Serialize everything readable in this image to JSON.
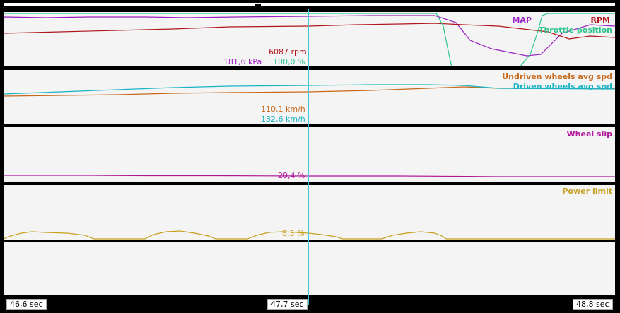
{
  "panels": {
    "engine": {
      "map_label": "MAP",
      "rpm_label": "RPM",
      "throttle_label": "Throttle position",
      "rpm_value": "6087 rpm",
      "map_value": "181,6 kPa",
      "throttle_value": "100,0 %"
    },
    "wheels": {
      "undriven_label": "Undriven wheels avg spd",
      "driven_label": "Driven wheels avg spd",
      "undriven_value": "110,1 km/h",
      "driven_value": "132,6 km/h"
    },
    "slip": {
      "label": "Wheel slip",
      "value": "20,4 %"
    },
    "power": {
      "label": "Power limit",
      "value": "6,3 %"
    }
  },
  "timeline": {
    "start": "46,6 sec",
    "cursor": "47,7 sec",
    "end": "48,8 sec"
  },
  "colors": {
    "map": "#9b1fc2",
    "rpm": "#b0161c",
    "throttle": "#2ec48c",
    "undriven": "#c8681a",
    "driven": "#18b4c4",
    "slip": "#b0169a",
    "power": "#c8a020",
    "cursor": "#3cc8d8"
  },
  "chart_data": [
    {
      "type": "line",
      "x_range": [
        46.6,
        48.8
      ],
      "series": [
        {
          "name": "MAP",
          "x": [
            46.6,
            46.9,
            47.2,
            47.5,
            47.7,
            48.0,
            48.2,
            48.3,
            48.4,
            48.5,
            48.6,
            48.7,
            48.8
          ],
          "y": [
            181,
            180,
            180,
            181,
            181.6,
            182,
            182,
            175,
            120,
            100,
            98,
            175,
            180
          ]
        },
        {
          "name": "RPM",
          "x": [
            46.6,
            46.9,
            47.2,
            47.5,
            47.7,
            48.0,
            48.2,
            48.4,
            48.5,
            48.6,
            48.7,
            48.8
          ],
          "y": [
            5850,
            5900,
            5980,
            6040,
            6087,
            6120,
            6130,
            6100,
            6090,
            6060,
            6010,
            6020
          ]
        },
        {
          "name": "Throttle position",
          "x": [
            46.6,
            48.2,
            48.25,
            48.28,
            48.5,
            48.55,
            48.6,
            48.8
          ],
          "y": [
            100,
            100,
            80,
            5,
            5,
            60,
            100,
            100
          ]
        }
      ]
    },
    {
      "type": "line",
      "x_range": [
        46.6,
        48.8
      ],
      "series": [
        {
          "name": "Undriven wheels avg spd",
          "x": [
            46.6,
            47.0,
            47.4,
            47.7,
            48.0,
            48.2,
            48.4,
            48.8
          ],
          "y": [
            103,
            104.5,
            107,
            110.1,
            112,
            113.5,
            112.5,
            112
          ]
        },
        {
          "name": "Driven wheels avg spd",
          "x": [
            46.6,
            47.0,
            47.4,
            47.7,
            48.0,
            48.2,
            48.4,
            48.8
          ],
          "y": [
            117,
            121,
            128,
            132.6,
            134,
            134,
            131,
            129
          ]
        }
      ]
    },
    {
      "type": "line",
      "x_range": [
        46.6,
        48.8
      ],
      "series": [
        {
          "name": "Wheel slip",
          "x": [
            46.6,
            46.8,
            47.0,
            47.2,
            47.4,
            47.7,
            48.0,
            48.2,
            48.4,
            48.6,
            48.8
          ],
          "y": [
            21,
            21,
            20.8,
            20.8,
            20.6,
            20.4,
            20.4,
            20,
            19.8,
            19.8,
            19.8
          ]
        }
      ]
    },
    {
      "type": "line",
      "x_range": [
        46.6,
        48.8
      ],
      "series": [
        {
          "name": "Power limit",
          "x": [
            46.6,
            46.65,
            46.75,
            46.9,
            46.95,
            47.1,
            47.15,
            47.3,
            47.4,
            47.45,
            47.55,
            47.7,
            47.75,
            47.85,
            47.95,
            48.05,
            48.15,
            48.2,
            48.8
          ],
          "y": [
            0,
            4,
            6,
            3,
            0,
            0,
            5,
            6,
            2,
            0,
            0,
            6.3,
            5,
            0,
            0,
            5,
            6,
            0,
            0
          ]
        }
      ]
    }
  ]
}
